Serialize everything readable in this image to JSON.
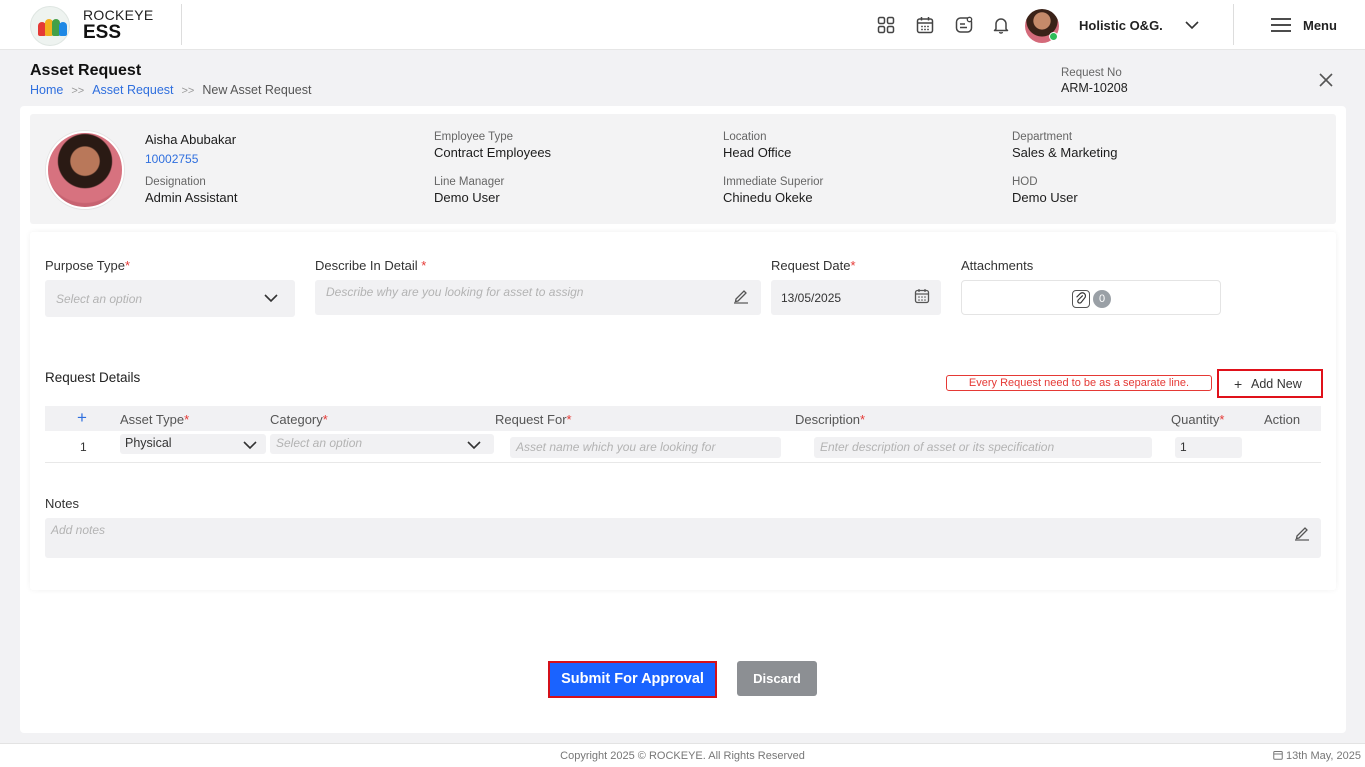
{
  "brand": {
    "line1": "ROCKEYE",
    "line2": "ESS"
  },
  "topbar": {
    "org_name": "Holistic O&G.",
    "menu_label": "Menu"
  },
  "page": {
    "title": "Asset Request",
    "breadcrumb": [
      "Home",
      "Asset Request",
      "New Asset Request"
    ],
    "request_no_label": "Request No",
    "request_no": "ARM-10208"
  },
  "employee": {
    "name": "Aisha Abubakar",
    "id": "10002755",
    "designation_label": "Designation",
    "designation": "Admin Assistant",
    "employee_type_label": "Employee Type",
    "employee_type": "Contract Employees",
    "line_manager_label": "Line Manager",
    "line_manager": "Demo User",
    "location_label": "Location",
    "location": "Head Office",
    "immediate_superior_label": "Immediate Superior",
    "immediate_superior": "Chinedu Okeke",
    "department_label": "Department",
    "department": "Sales & Marketing",
    "hod_label": "HOD",
    "hod": "Demo User"
  },
  "form": {
    "purpose_type_label": "Purpose Type",
    "purpose_type_placeholder": "Select an option",
    "describe_label": "Describe In Detail ",
    "describe_placeholder": "Describe why are you looking for asset to assign",
    "request_date_label": "Request Date",
    "request_date": "13/05/2025",
    "attachments_label": "Attachments",
    "attachments_count": "0",
    "required_mark": "*"
  },
  "request_details": {
    "title": "Request Details",
    "warning": "Every Request need to be as a separate line.",
    "add_new_label": "Add New",
    "add_icon": "+",
    "columns": [
      "Asset Type",
      "Category",
      "Request For",
      "Description",
      "Quantity",
      "Action"
    ],
    "row": {
      "index": "1",
      "asset_type": "Physical",
      "category_placeholder": "Select an option",
      "request_for_placeholder": "Asset name which you are looking for",
      "description_placeholder": "Enter description of asset or its specification",
      "quantity": "1"
    }
  },
  "notes": {
    "label": "Notes",
    "placeholder": "Add notes"
  },
  "actions": {
    "submit": "Submit For Approval",
    "discard": "Discard"
  },
  "footer": {
    "copyright": "Copyright 2025 © ROCKEYE. All Rights Reserved",
    "date": "13th May, 2025"
  },
  "colors": {
    "primary": "#1a63ff",
    "link": "#2f6fde",
    "required": "#e53935",
    "highlight": "#d4101a",
    "discard": "#8c8f93"
  }
}
